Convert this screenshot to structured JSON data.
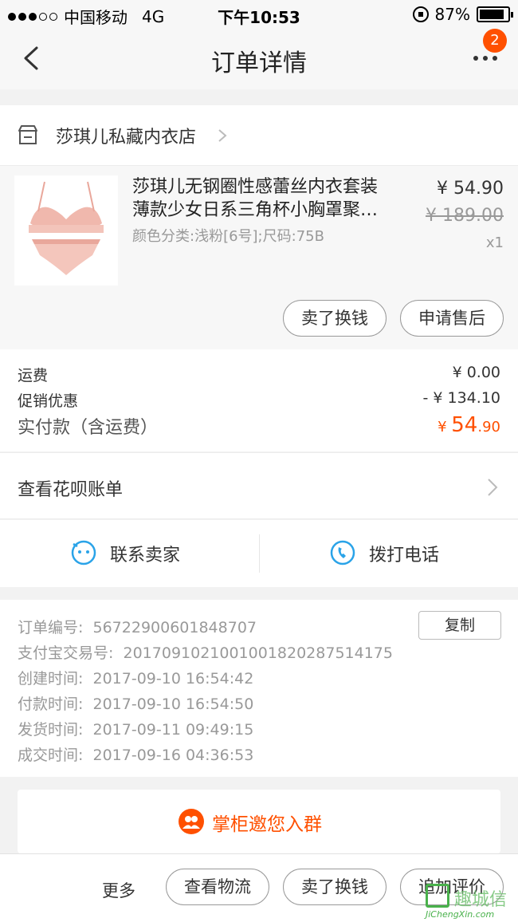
{
  "status_bar": {
    "carrier": "中国移动",
    "network": "4G",
    "time": "下午10:53",
    "battery_percent": "87%",
    "battery_level": 0.87
  },
  "nav": {
    "title": "订单详情",
    "badge_count": "2"
  },
  "shop": {
    "name": "莎琪儿私藏内衣店"
  },
  "product": {
    "title_line1": "莎琪儿无钢圈性感蕾丝内衣套装",
    "title_line2": "薄款少女日系三角杯小胸罩聚…",
    "sku": "颜色分类:浅粉[6号];尺码:75B",
    "price": "¥ 54.90",
    "original_price": "¥ 189.00",
    "quantity": "x1",
    "btn_sell": "卖了换钱",
    "btn_aftersale": "申请售后"
  },
  "fees": {
    "shipping_label": "运费",
    "shipping_value": "¥ 0.00",
    "promo_label": "促销优惠",
    "promo_value": "- ¥ 134.10",
    "total_label": "实付款（含运费）",
    "total_currency": "¥",
    "total_int": "54",
    "total_dec": ".90"
  },
  "huabei": {
    "label": "查看花呗账单"
  },
  "contact": {
    "seller": "联系卖家",
    "phone": "拨打电话"
  },
  "order_info": {
    "copy_label": "复制",
    "rows": [
      {
        "key": "订单编号:",
        "value": "56722900601848707"
      },
      {
        "key": "支付宝交易号:",
        "value": "2017091021001001820287514175"
      },
      {
        "key": "创建时间:",
        "value": "2017-09-10 16:54:42"
      },
      {
        "key": "付款时间:",
        "value": "2017-09-10 16:54:50"
      },
      {
        "key": "发货时间:",
        "value": "2017-09-11 09:49:15"
      },
      {
        "key": "成交时间:",
        "value": "2017-09-16 04:36:53"
      }
    ]
  },
  "group": {
    "label": "掌柜邀您入群"
  },
  "bottom_bar": {
    "more": "更多",
    "logistics": "查看物流",
    "sell": "卖了换钱",
    "review": "追加评价"
  },
  "watermark": {
    "cn": "趣城信",
    "en": "JiChengXin.com"
  },
  "colors": {
    "accent": "#ff5000",
    "blue_icon": "#2aa3e8"
  }
}
